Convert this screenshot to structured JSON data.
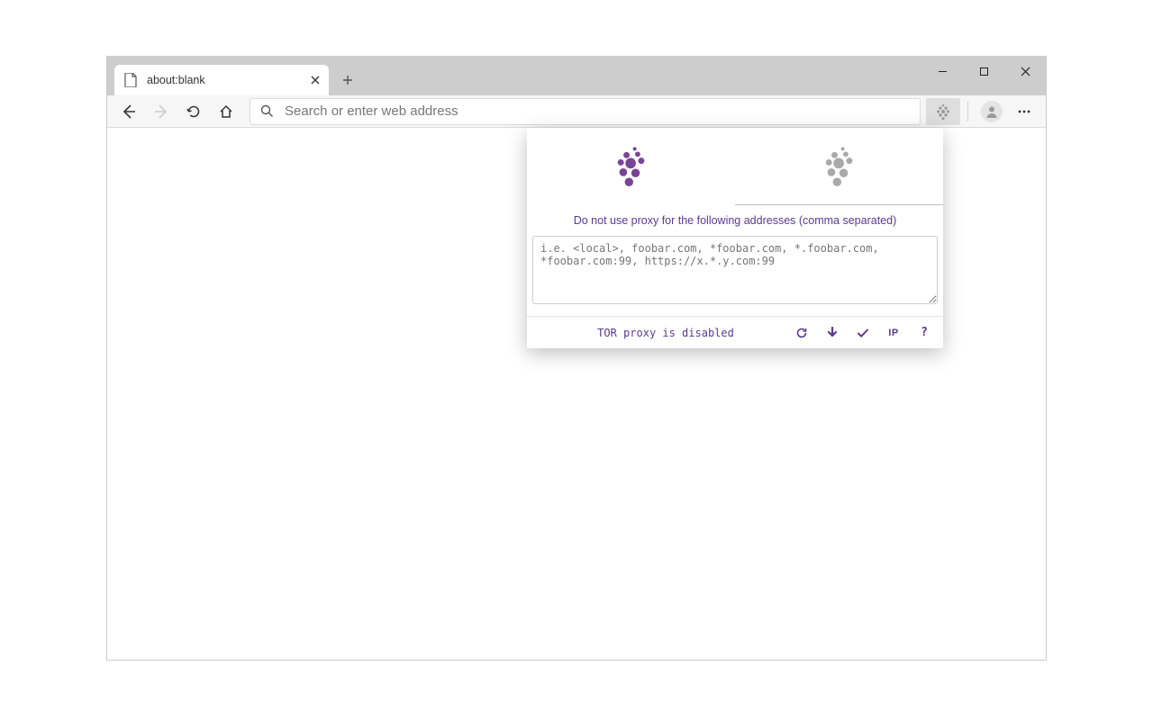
{
  "tab": {
    "title": "about:blank"
  },
  "address_bar": {
    "placeholder": "Search or enter web address"
  },
  "popup": {
    "exceptions_label": "Do not use proxy for the following addresses (comma separated)",
    "textarea_placeholder": "i.e. <local>, foobar.com, *foobar.com, *.foobar.com, *foobar.com:99, https://x.*.y.com:99",
    "status_text": "TOR proxy is disabled",
    "ip_label": "IP",
    "help_label": "?"
  },
  "colors": {
    "accent": "#5a3a8f",
    "grape_purple": "#7b4397",
    "grape_grey": "#a0a0a0"
  }
}
